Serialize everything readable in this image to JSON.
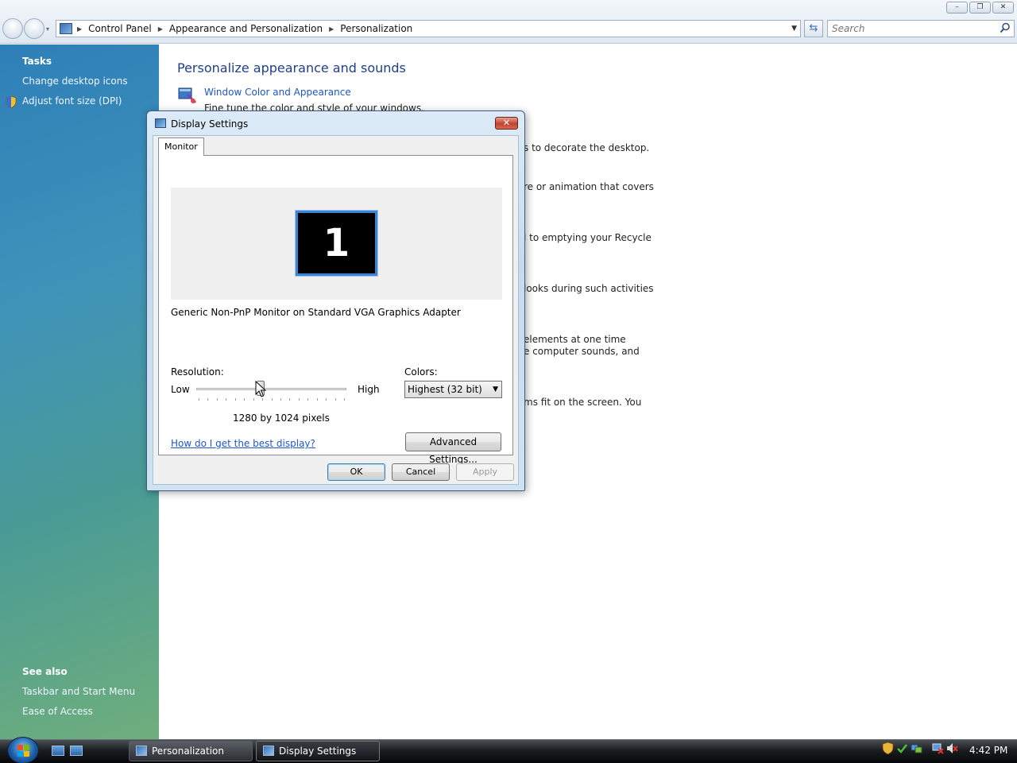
{
  "explorer": {
    "breadcrumb": [
      "Control Panel",
      "Appearance and Personalization",
      "Personalization"
    ],
    "search_placeholder": "Search"
  },
  "left_pane": {
    "tasks_heading": "Tasks",
    "tasks": [
      "Change desktop icons",
      "Adjust font size (DPI)"
    ],
    "see_also_heading": "See also",
    "see_also": [
      "Taskbar and Start Menu",
      "Ease of Access"
    ]
  },
  "main": {
    "title": "Personalize appearance and sounds",
    "first_link": "Window Color and Appearance",
    "first_desc": "Fine tune the color and style of your windows.",
    "fragments": [
      "s to decorate the desktop.",
      "re or animation that covers",
      "l to emptying your Recycle",
      "looks during such activities",
      "elements at one time",
      "e computer sounds, and",
      "ms fit on the screen. You"
    ]
  },
  "dialog": {
    "title": "Display Settings",
    "close_label": "✕",
    "tab": "Monitor",
    "monitor_number": "1",
    "monitor_name": "Generic Non-PnP Monitor on Standard VGA Graphics Adapter",
    "resolution_label": "Resolution:",
    "low_label": "Low",
    "high_label": "High",
    "resolution_value": "1280 by 1024 pixels",
    "resolution_slider_fraction": 0.43,
    "colors_label": "Colors:",
    "colors_value": "Highest (32 bit)",
    "help_link": "How do I get the best display?",
    "advanced_button": "Advanced Settings...",
    "ok_button": "OK",
    "cancel_button": "Cancel",
    "apply_button": "Apply"
  },
  "taskbar": {
    "tasks": [
      "Personalization",
      "Display Settings"
    ],
    "clock": "4:42 PM"
  },
  "colors": {
    "link": "#1e56c8",
    "title": "#1e3f8a",
    "close_button": "#c1422c"
  }
}
